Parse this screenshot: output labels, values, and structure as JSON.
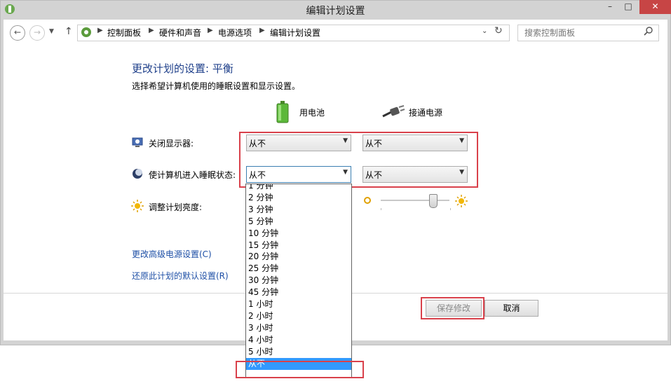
{
  "window": {
    "title": "编辑计划设置",
    "minimize_glyph": "–",
    "maximize_glyph": "□",
    "close_glyph": "✕"
  },
  "address_bar": {
    "breadcrumbs": [
      "控制面板",
      "硬件和声音",
      "电源选项",
      "编辑计划设置"
    ],
    "search_placeholder": "搜索控制面板"
  },
  "main": {
    "heading": "更改计划的设置: 平衡",
    "subheading": "选择希望计算机使用的睡眠设置和显示设置。",
    "columns": {
      "battery": "用电池",
      "plugged": "接通电源"
    },
    "settings": [
      {
        "label": "关闭显示器:",
        "battery_value": "从不",
        "plugged_value": "从不"
      },
      {
        "label": "使计算机进入睡眠状态:",
        "battery_value": "从不",
        "plugged_value": "从不"
      },
      {
        "label": "调整计划亮度:"
      }
    ],
    "links": {
      "advanced": "更改高级电源设置(C)",
      "restore": "还原此计划的默认设置(R)"
    }
  },
  "dropdown": {
    "options": [
      "1 分钟",
      "2 分钟",
      "3 分钟",
      "5 分钟",
      "10 分钟",
      "15 分钟",
      "20 分钟",
      "25 分钟",
      "30 分钟",
      "45 分钟",
      "1 小时",
      "2 小时",
      "3 小时",
      "4 小时",
      "5 小时",
      "从不"
    ],
    "selected": "从不"
  },
  "buttons": {
    "save": "保存修改",
    "cancel": "取消"
  },
  "colors": {
    "highlight_red": "#d9414b",
    "selection_blue": "#3399ff",
    "heading_blue": "#1e3f8a"
  }
}
